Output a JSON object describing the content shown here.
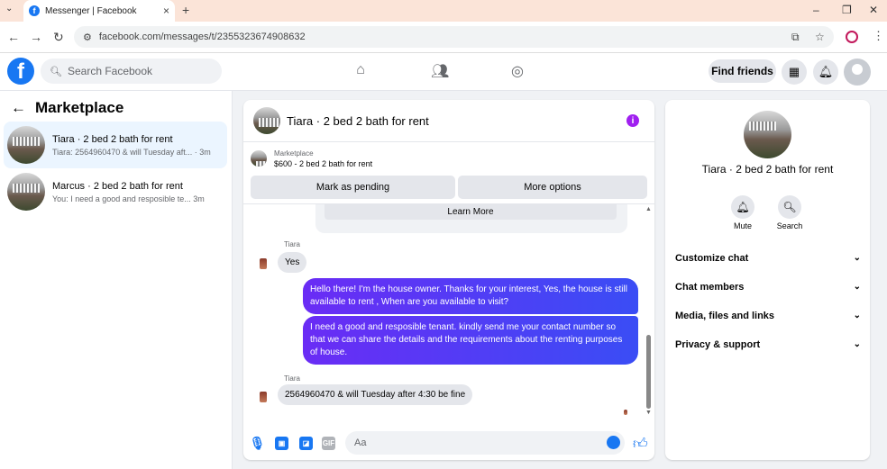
{
  "browser": {
    "tab_title": "Messenger | Facebook",
    "tab_favicon": "facebook-icon",
    "new_tab": "+",
    "url": "facebook.com/messages/t/2355323674908632"
  },
  "fb": {
    "search_placeholder": "Search Facebook",
    "find_friends": "Find friends"
  },
  "sidebar": {
    "title": "Marketplace",
    "conversations": [
      {
        "name": "Tiara · 2 bed 2 bath for rent",
        "snippet": "Tiara: 2564960470 & will Tuesday aft... · 3m",
        "active": true
      },
      {
        "name": "Marcus · 2 bed 2 bath for rent",
        "snippet": "You: I need a good and resposible te...  3m",
        "active": false
      }
    ]
  },
  "chat": {
    "title": "Tiara · 2 bed 2 bath for rent",
    "marketplace_label": "Marketplace",
    "listing": "$600 - 2 bed 2 bath for rent",
    "mark_pending": "Mark as pending",
    "more_options": "More options",
    "learn_more": "Learn More",
    "messages": [
      {
        "sender": "Tiara",
        "text": "Yes",
        "direction": "in"
      },
      {
        "text": "Hello there! I'm the house owner. Thanks for your interest, Yes, the house is still available to rent , When are you available to visit?",
        "direction": "out"
      },
      {
        "text": "I need a good and resposible tenant.  kindly send me your contact number so that we can share the details and the requirements about the renting purposes of house.",
        "direction": "out"
      },
      {
        "sender": "Tiara",
        "text": "2564960470 & will Tuesday after 4:30 be fine",
        "direction": "in"
      }
    ],
    "composer_placeholder": "Aa",
    "gif_label": "GIF"
  },
  "details": {
    "name": "Tiara · 2 bed 2 bath for rent",
    "mute": "Mute",
    "search": "Search",
    "sections": [
      "Customize chat",
      "Chat members",
      "Media, files and links",
      "Privacy & support"
    ]
  },
  "colors": {
    "brand": "#1877f2",
    "outgoing_start": "#6a2cf5",
    "outgoing_end": "#3a4df5",
    "info": "#a020f0"
  }
}
